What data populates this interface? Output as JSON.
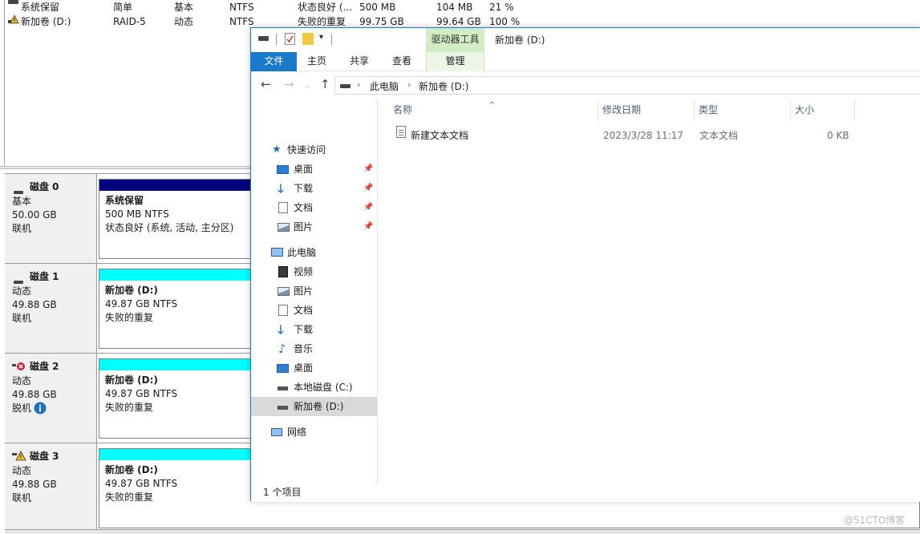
{
  "disk_management": {
    "volumes": [
      {
        "name": "系统保留",
        "layout": "简单",
        "type": "基本",
        "fs": "NTFS",
        "status": "状态良好 (...",
        "capacity": "500 MB",
        "free": "104 MB",
        "pct": "21 %",
        "icon": "drive-icon"
      },
      {
        "name": "新加卷 (D:)",
        "layout": "RAID-5",
        "type": "动态",
        "fs": "NTFS",
        "status": "失败的重复",
        "capacity": "99.75 GB",
        "free": "99.64 GB",
        "pct": "100 %",
        "icon": "warning-drive-icon"
      }
    ],
    "disks": [
      {
        "name": "磁盘 0",
        "kind": "基本",
        "size": "50.00 GB",
        "state": "联机",
        "icon": "disk-icon",
        "part_title": "系统保留",
        "part_line2": "500 MB NTFS",
        "part_line3": "状态良好 (系统, 活动, 主分区)",
        "bar_color": "#00007f"
      },
      {
        "name": "磁盘 1",
        "kind": "动态",
        "size": "49.88 GB",
        "state": "联机",
        "icon": "disk-icon",
        "part_title": "新加卷 (D:)",
        "part_line2": "49.87 GB NTFS",
        "part_line3": "失败的重复",
        "bar_color": "#00ffff"
      },
      {
        "name": "磁盘 2",
        "kind": "动态",
        "size": "49.88 GB",
        "state": "脱机",
        "icon": "disk-error-icon",
        "part_title": "新加卷 (D:)",
        "part_line2": "49.87 GB NTFS",
        "part_line3": "失败的重复",
        "bar_color": "#00ffff"
      },
      {
        "name": "磁盘 3",
        "kind": "动态",
        "size": "49.88 GB",
        "state": "联机",
        "icon": "disk-warning-icon",
        "part_title": "新加卷 (D:)",
        "part_line2": "49.87 GB NTFS",
        "part_line3": "失败的重复",
        "bar_color": "#00ffff"
      }
    ]
  },
  "explorer": {
    "title": "新加卷 (D:)",
    "contextual_tab_group": "驱动器工具",
    "tabs": {
      "file": "文件",
      "home": "主页",
      "share": "共享",
      "view": "查看",
      "manage": "管理"
    },
    "address": {
      "root": "此电脑",
      "current": "新加卷 (D:)"
    },
    "nav": {
      "quick_access": "快速访问",
      "qa_desktop": "桌面",
      "qa_downloads": "下载",
      "qa_documents": "文档",
      "qa_pictures": "图片",
      "this_pc": "此电脑",
      "videos": "视频",
      "pictures": "图片",
      "documents": "文档",
      "downloads": "下载",
      "music": "音乐",
      "desktop": "桌面",
      "local_disk_c": "本地磁盘 (C:)",
      "new_volume_d": "新加卷 (D:)",
      "network": "网络"
    },
    "columns": {
      "name": "名称",
      "date": "修改日期",
      "type": "类型",
      "size": "大小"
    },
    "files": [
      {
        "name": "新建文本文档",
        "date": "2023/3/28 11:17",
        "type": "文本文档",
        "size": "0 KB"
      }
    ],
    "status": "1 个项目"
  },
  "watermark": "@51CTO博客"
}
